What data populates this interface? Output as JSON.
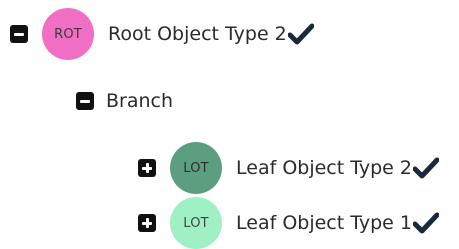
{
  "tree": {
    "root": {
      "avatar_text": "ROT",
      "avatar_color": "#f06fc4",
      "label": "Root Object Type 2",
      "expanded": true,
      "checked": true
    },
    "branch": {
      "label": "Branch",
      "expanded": true
    },
    "leaves": [
      {
        "avatar_text": "LOT",
        "avatar_color": "#5c9e80",
        "label": "Leaf Object Type 2",
        "expanded": false,
        "checked": true
      },
      {
        "avatar_text": "LOT",
        "avatar_color": "#9ff0c5",
        "label": "Leaf Object Type 1",
        "expanded": false,
        "checked": true
      }
    ]
  },
  "icons": {
    "collapse": "minus-square-icon",
    "expand": "plus-square-icon",
    "check": "checkmark-icon"
  }
}
